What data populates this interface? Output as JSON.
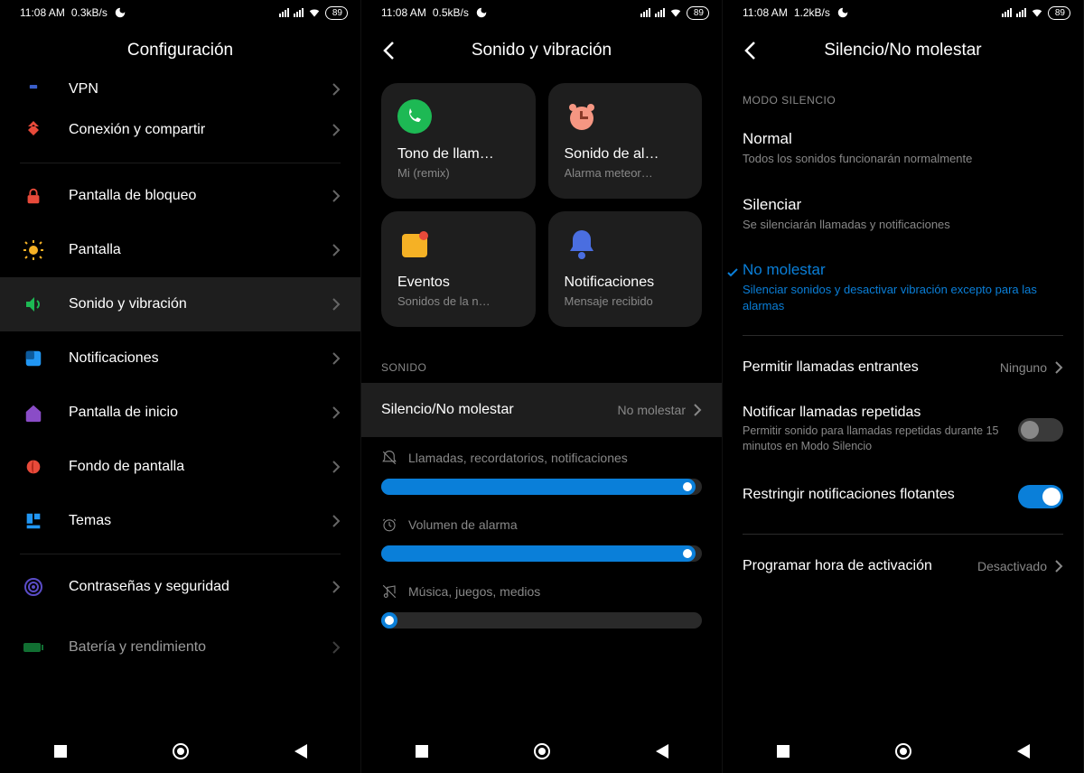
{
  "panel1": {
    "status": {
      "time": "11:08 AM",
      "speed": "0.3kB/s",
      "battery": "89"
    },
    "title": "Configuración",
    "items": [
      {
        "key": "vpn",
        "label": "VPN",
        "icon": "vpn",
        "partial": true
      },
      {
        "key": "share",
        "label": "Conexión y compartir",
        "icon": "share"
      },
      {
        "key": "lock",
        "label": "Pantalla de bloqueo",
        "icon": "lock"
      },
      {
        "key": "display",
        "label": "Pantalla",
        "icon": "sun"
      },
      {
        "key": "sound",
        "label": "Sonido y vibración",
        "icon": "volume",
        "selected": true
      },
      {
        "key": "notif",
        "label": "Notificaciones",
        "icon": "notif"
      },
      {
        "key": "home",
        "label": "Pantalla de inicio",
        "icon": "home"
      },
      {
        "key": "wallpaper",
        "label": "Fondo de pantalla",
        "icon": "wallpaper"
      },
      {
        "key": "themes",
        "label": "Temas",
        "icon": "theme"
      },
      {
        "key": "security",
        "label": "Contraseñas y seguridad",
        "icon": "security"
      },
      {
        "key": "battery",
        "label": "Batería y rendimiento",
        "icon": "battery",
        "partial": true
      }
    ]
  },
  "panel2": {
    "status": {
      "time": "11:08 AM",
      "speed": "0.5kB/s",
      "battery": "89"
    },
    "title": "Sonido y vibración",
    "cards": [
      {
        "title": "Tono de llam…",
        "sub": "Mi (remix)",
        "icon": "phone"
      },
      {
        "title": "Sonido de al…",
        "sub": "Alarma meteor…",
        "icon": "alarm"
      },
      {
        "title": "Eventos",
        "sub": "Sonidos de la n…",
        "icon": "calendar"
      },
      {
        "title": "Notificaciones",
        "sub": "Mensaje recibido",
        "icon": "bell"
      }
    ],
    "section": "SONIDO",
    "silence_row": {
      "label": "Silencio/No molestar",
      "value": "No molestar"
    },
    "sliders": [
      {
        "label": "Llamadas, recordatorios, notificaciones",
        "icon": "bell-off",
        "pct": 98
      },
      {
        "label": "Volumen de alarma",
        "icon": "alarm",
        "pct": 98
      },
      {
        "label": "Música, juegos, medios",
        "icon": "music-off",
        "pct": 5
      }
    ]
  },
  "panel3": {
    "status": {
      "time": "11:08 AM",
      "speed": "1.2kB/s",
      "battery": "89"
    },
    "title": "Silencio/No molestar",
    "section": "MODO SILENCIO",
    "options": [
      {
        "title": "Normal",
        "sub": "Todos los sonidos funcionarán normalmente"
      },
      {
        "title": "Silenciar",
        "sub": "Se silenciarán llamadas y notificaciones"
      },
      {
        "title": "No molestar",
        "sub": "Silenciar sonidos y desactivar vibración excepto para las alarmas",
        "active": true
      }
    ],
    "rows": [
      {
        "type": "nav",
        "label": "Permitir llamadas entrantes",
        "value": "Ninguno"
      },
      {
        "type": "toggle",
        "title": "Notificar llamadas repetidas",
        "sub": "Permitir sonido para llamadas repetidas durante 15 minutos en Modo Silencio",
        "on": false
      },
      {
        "type": "toggle",
        "title": "Restringir notificaciones flotantes",
        "sub": "",
        "on": true
      },
      {
        "type": "nav",
        "label": "Programar hora de activación",
        "value": "Desactivado"
      }
    ]
  }
}
